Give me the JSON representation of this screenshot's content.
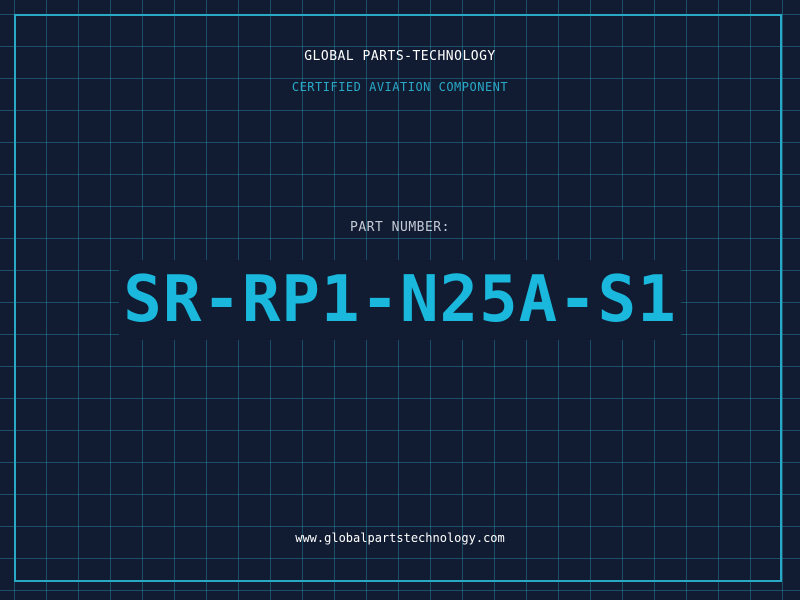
{
  "header": {
    "company": "GLOBAL PARTS-TECHNOLOGY",
    "subtitle": "CERTIFIED AVIATION COMPONENT"
  },
  "part": {
    "label": "PART NUMBER:",
    "number": "SR-RP1-N25A-S1"
  },
  "footer": {
    "website": "www.globalpartstechnology.com"
  },
  "colors": {
    "background": "#111c33",
    "grid": "#288caa",
    "accent": "#1ab8dc",
    "label": "#c4cbd6",
    "text": "#ffffff"
  }
}
